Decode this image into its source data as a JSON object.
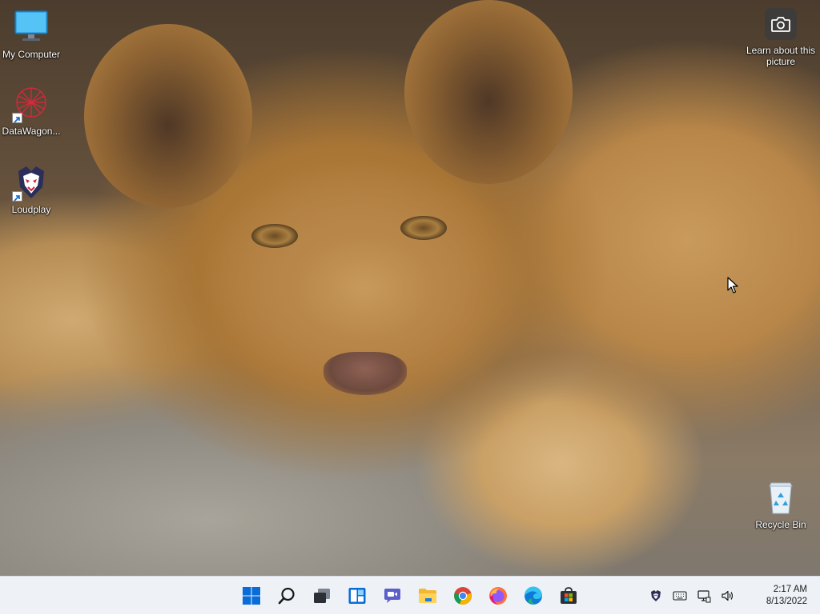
{
  "desktop": {
    "icons": [
      {
        "label": "My Computer",
        "icon": "monitor-icon"
      },
      {
        "label": "DataWagon...",
        "icon": "datawagon-icon"
      },
      {
        "label": "Loudplay",
        "icon": "loudplay-icon"
      }
    ],
    "learn_picture": {
      "label": "Learn about this picture",
      "icon": "camera-icon"
    },
    "recycle_bin": {
      "label": "Recycle Bin",
      "icon": "recycle-bin-icon"
    }
  },
  "taskbar": {
    "apps": [
      {
        "name": "start",
        "icon": "windows-logo-icon"
      },
      {
        "name": "search",
        "icon": "search-icon"
      },
      {
        "name": "task-view",
        "icon": "task-view-icon"
      },
      {
        "name": "widgets",
        "icon": "widgets-icon"
      },
      {
        "name": "chat",
        "icon": "chat-icon"
      },
      {
        "name": "file-explorer",
        "icon": "folder-icon"
      },
      {
        "name": "chrome",
        "icon": "chrome-icon"
      },
      {
        "name": "firefox",
        "icon": "firefox-icon"
      },
      {
        "name": "edge",
        "icon": "edge-icon"
      },
      {
        "name": "store",
        "icon": "store-icon"
      }
    ],
    "tray": {
      "icons": [
        "loudplay-tray-icon",
        "keyboard-icon",
        "network-icon",
        "volume-icon"
      ],
      "time": "2:17 AM",
      "date": "8/13/2022"
    }
  },
  "colors": {
    "taskbar_bg": "#eef1f6",
    "windows_blue": "#0a6cd8",
    "folder_yellow": "#f5b631"
  }
}
